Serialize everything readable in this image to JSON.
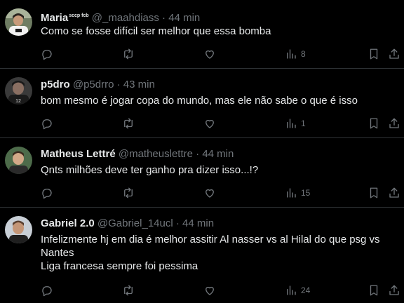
{
  "tweets": [
    {
      "name": "Maria",
      "badge": "sccp fcb",
      "handle": "@_maahdiass",
      "dot": "·",
      "time": "44 min",
      "text": "Como se fosse difícil ser melhor que essa bomba",
      "views": "8"
    },
    {
      "name": "p5dro",
      "handle": "@p5drro",
      "dot": "·",
      "time": "43 min",
      "text": "bom mesmo é jogar copa do mundo, mas ele não sabe o que é isso",
      "views": "1"
    },
    {
      "name": "Matheus Lettré",
      "handle": "@matheuslettre",
      "dot": "·",
      "time": "44 min",
      "text": "Qnts milhões deve ter ganho pra dizer isso...!?",
      "views": "15"
    },
    {
      "name": "Gabriel 2.0",
      "handle": "@Gabriel_14ucl",
      "dot": "·",
      "time": "44 min",
      "text_lines": [
        "Infelizmente hj em dia é melhor assitir Al nasser vs al Hilal do que psg vs",
        "Nantes",
        "Liga francesa sempre foi pessima"
      ],
      "views": "24"
    }
  ],
  "icons": {
    "reply": "reply-icon",
    "retweet": "retweet-icon",
    "like": "like-icon",
    "views": "views-icon",
    "bookmark": "bookmark-icon",
    "share": "share-icon"
  },
  "colors": {
    "background": "#000000",
    "text": "#e7e9ea",
    "muted": "#71767b",
    "divider": "#2f3336"
  }
}
